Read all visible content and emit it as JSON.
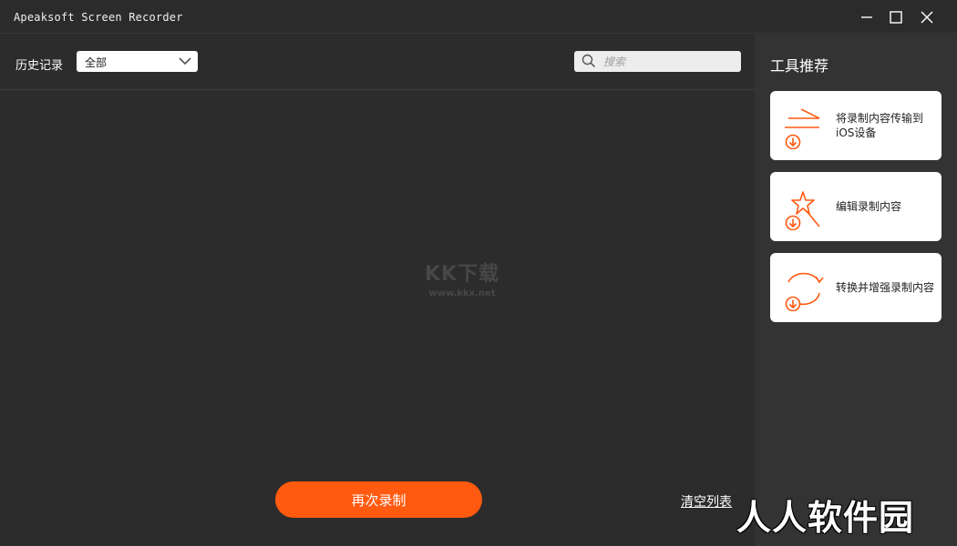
{
  "window": {
    "title": "Apeaksoft Screen Recorder",
    "controls": [
      "minimize-icon",
      "maximize-icon",
      "close-icon"
    ]
  },
  "history": {
    "label": "历史记录",
    "filter": {
      "selected": "全部"
    },
    "search": {
      "placeholder": "搜索",
      "value": ""
    }
  },
  "watermark": {
    "logo": "KK下载",
    "url": "www.kkx.net"
  },
  "actions": {
    "record_again": "再次录制",
    "clear_list": "清空列表"
  },
  "sidebar": {
    "title": "工具推荐",
    "tools": [
      {
        "label": "将录制内容传输到iOS设备",
        "icon": "transfer-icon"
      },
      {
        "label": "编辑录制内容",
        "icon": "edit-magic-icon"
      },
      {
        "label": "转换并增强录制内容",
        "icon": "convert-icon"
      }
    ]
  },
  "brand_mark": "人人软件园",
  "colors": {
    "accent": "#ff5a10",
    "background": "#2c2c2c",
    "sidebar": "#333333",
    "card": "#ffffff"
  }
}
